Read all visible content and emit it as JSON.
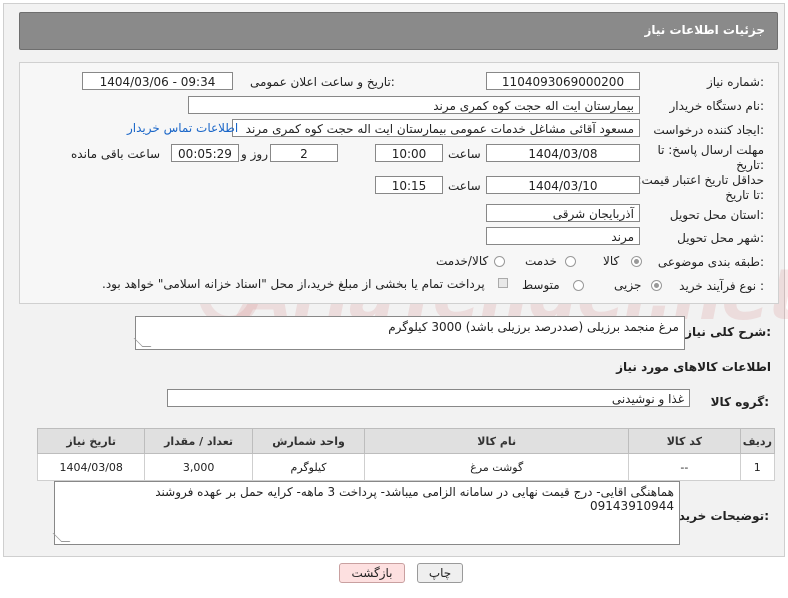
{
  "header": {
    "title": "جزئیات اطلاعات نیاز"
  },
  "form": {
    "need_number_label": "شماره نیاز:",
    "need_number": "1104093069000200",
    "announce_label": "تاریخ و ساعت اعلان عمومی:",
    "announce_value": "1404/03/06 - 09:34",
    "buyer_org_label": "نام دستگاه خریدار:",
    "buyer_org": "بیمارستان ایت اله حجت کوه کمری مرند",
    "creator_label": "ایجاد کننده درخواست:",
    "creator": "مسعود آقائی مشاغل خدمات عمومی بیمارستان ایت اله حجت کوه کمری مرند",
    "contact_link": "اطلاعات تماس خریدار",
    "deadline_label": "مهلت ارسال پاسخ: تا تاریخ:",
    "deadline_date": "1404/03/08",
    "time_label": "ساعت",
    "deadline_time": "10:00",
    "days_value": "2",
    "days_label": "روز و",
    "remaining_value": "00:05:29",
    "remaining_label": "ساعت باقی مانده",
    "validity_label": "حداقل تاریخ اعتبار قیمت: تا تاریخ:",
    "validity_date": "1404/03/10",
    "validity_time": "10:15",
    "province_label": "استان محل تحویل:",
    "province": "آذربایجان شرقی",
    "city_label": "شهر محل تحویل:",
    "city": "مرند",
    "category_label": "طبقه بندی موضوعی:",
    "category_options": [
      "کالا",
      "خدمت",
      "کالا/خدمت"
    ],
    "category_selected": "کالا",
    "process_label": "نوع فرآیند خرید :",
    "process_options": [
      "جزیی",
      "متوسط"
    ],
    "process_selected": "جزیی",
    "payment_note": "پرداخت تمام یا بخشی از مبلغ خرید،از محل \"اسناد خزانه اسلامی\" خواهد بود."
  },
  "description": {
    "label": "شرح کلی نیاز:",
    "value": "مرغ منجمد برزیلی (صددرصد برزیلی باشد) 3000 کیلوگرم"
  },
  "goods": {
    "section_title": "اطلاعات کالاهای مورد نیاز",
    "group_label": "گروه کالا:",
    "group_value": "غذا و نوشیدنی",
    "columns": [
      "ردیف",
      "کد کالا",
      "نام کالا",
      "واحد شمارش",
      "تعداد / مقدار",
      "تاریخ نیاز"
    ],
    "rows": [
      [
        "1",
        "--",
        "گوشت مرغ",
        "کیلوگرم",
        "3,000",
        "1404/03/08"
      ]
    ]
  },
  "buyer_notes": {
    "label": "توضیحات خریدار:",
    "line1": "هماهنگی اقایی- درج قیمت نهایی در سامانه الزامی میباشد- پرداخت 3 ماهه- کرایه حمل بر عهده فروشند",
    "line2": "09143910944"
  },
  "buttons": {
    "print": "چاپ",
    "back": "بازگشت"
  },
  "watermark": "AriaTender.net"
}
